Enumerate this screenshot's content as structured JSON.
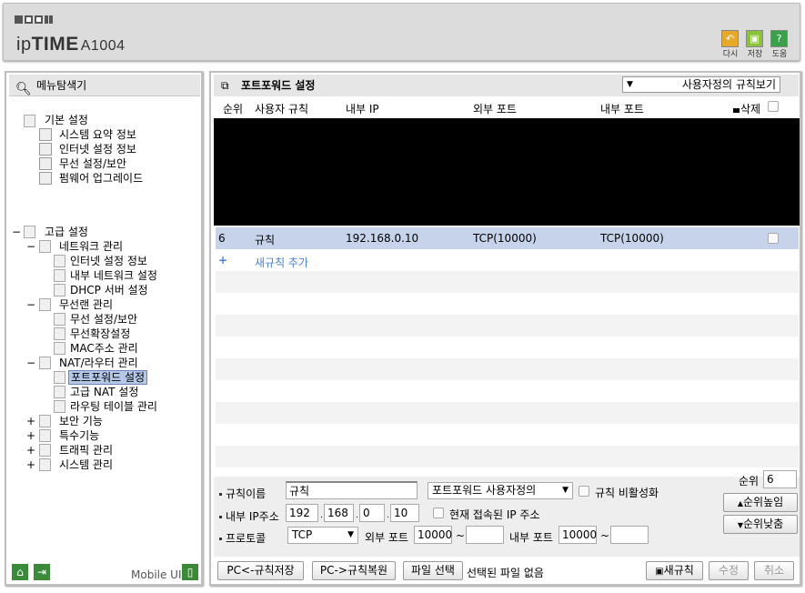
{
  "header": {
    "brand_prefix": "ip",
    "brand_bold": "TIME",
    "model": "A1004",
    "buttons": [
      {
        "label": "다시",
        "color": "#e6a92a",
        "icon": "undo-icon"
      },
      {
        "label": "저장",
        "color": "#8ac23a",
        "icon": "save-icon"
      },
      {
        "label": "도움",
        "color": "#3aa04a",
        "icon": "help-icon"
      }
    ]
  },
  "sidebar": {
    "title": "메뉴탐색기",
    "basic": {
      "label": "기본 설정",
      "items": [
        "시스템 요약 정보",
        "인터넷 설정 정보",
        "무선 설정/보안",
        "펌웨어 업그레이드"
      ]
    },
    "advanced": {
      "label": "고급 설정",
      "groups": [
        {
          "label": "네트워크 관리",
          "toggle": "−",
          "items": [
            "인터넷 설정 정보",
            "내부 네트워크 설정",
            "DHCP 서버 설정"
          ]
        },
        {
          "label": "무선랜 관리",
          "toggle": "−",
          "items": [
            "무선 설정/보안",
            "무선확장설정",
            "MAC주소 관리"
          ]
        },
        {
          "label": "NAT/라우터 관리",
          "toggle": "−",
          "items": [
            "포트포워드 설정",
            "고급 NAT 설정",
            "라우팅 테이블 관리"
          ]
        },
        {
          "label": "보안 기능",
          "toggle": "+"
        },
        {
          "label": "특수기능",
          "toggle": "+"
        },
        {
          "label": "트래픽 관리",
          "toggle": "+"
        },
        {
          "label": "시스템 관리",
          "toggle": "+"
        }
      ]
    },
    "footer": {
      "mobile_label": "Mobile UI"
    }
  },
  "main": {
    "title": "포트포워드 설정",
    "view_select": "사용자정의 규칙보기",
    "columns": [
      "순위",
      "사용자 규칙",
      "내부 IP",
      "외부 포트",
      "내부 포트",
      "삭제"
    ],
    "rows": [
      {
        "rank": "6",
        "name": "규칙",
        "ip": "192.168.0.10",
        "ext": "TCP(10000)",
        "int": "TCP(10000)"
      }
    ],
    "add_rule": "새규칙 추가",
    "form": {
      "name_label": "규칙이름",
      "name_value": "규칙",
      "preset_select": "포트포워드 사용자정의",
      "disable_label": "규칙 비활성화",
      "ip_label": "내부 IP주소",
      "ip": [
        "192",
        "168",
        "0",
        "10"
      ],
      "connected_label": "현재 접속된 IP 주소",
      "proto_label": "프로토콜",
      "proto": "TCP",
      "ext_label": "외부 포트",
      "ext_from": "10000",
      "ext_to": "",
      "int_label": "내부 포트",
      "int_from": "10000",
      "int_to": "",
      "tilde": "~",
      "rank_label": "순위",
      "rank_value": "6",
      "up": "순위높임",
      "down": "순위낮춤"
    },
    "buttons": {
      "pc_save": "PC<-규칙저장",
      "pc_restore": "PC->규칙복원",
      "file_select": "파일 선택",
      "file_none": "선택된 파일 없음",
      "new_rule": "새규칙",
      "modify": "수정",
      "cancel": "취소"
    }
  }
}
